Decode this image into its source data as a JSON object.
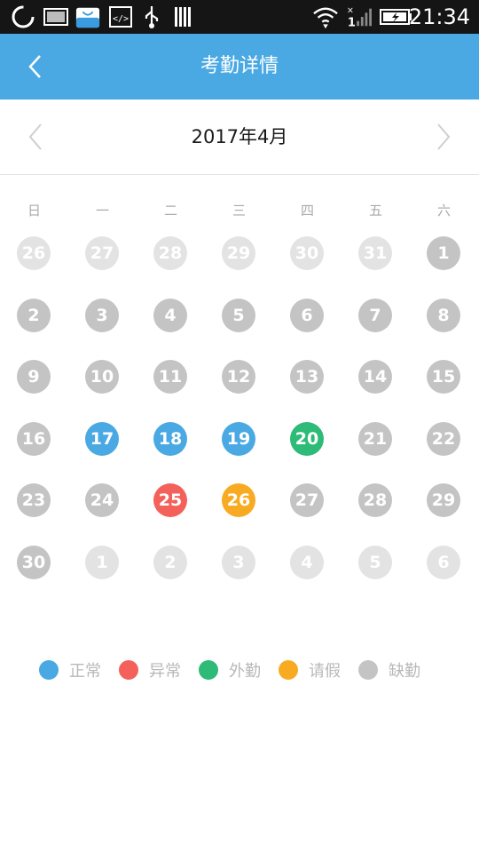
{
  "status_bar": {
    "time": "21:34",
    "icons": [
      "loading-icon",
      "image-icon",
      "store-icon",
      "code-icon",
      "usb-icon",
      "barcode-icon",
      "wifi-icon",
      "signal-icon",
      "battery-charging-icon"
    ]
  },
  "app_bar": {
    "back_icon": "chevron-left-icon",
    "title": "考勤详情",
    "color": "#4aa9e3"
  },
  "month_nav": {
    "title": "2017年4月",
    "prev_icon": "chevron-left-icon",
    "next_icon": "chevron-right-icon"
  },
  "weekdays": [
    "日",
    "一",
    "二",
    "三",
    "四",
    "五",
    "六"
  ],
  "colors": {
    "normal": "#4aa9e3",
    "abnormal": "#f4615a",
    "field": "#2dbb77",
    "leave": "#f8ab22",
    "absent": "#c4c4c4",
    "other_month": "#e3e3e3"
  },
  "calendar": [
    [
      {
        "d": "26",
        "s": "other_month"
      },
      {
        "d": "27",
        "s": "other_month"
      },
      {
        "d": "28",
        "s": "other_month"
      },
      {
        "d": "29",
        "s": "other_month"
      },
      {
        "d": "30",
        "s": "other_month"
      },
      {
        "d": "31",
        "s": "other_month"
      },
      {
        "d": "1",
        "s": "absent"
      }
    ],
    [
      {
        "d": "2",
        "s": "absent"
      },
      {
        "d": "3",
        "s": "absent"
      },
      {
        "d": "4",
        "s": "absent"
      },
      {
        "d": "5",
        "s": "absent"
      },
      {
        "d": "6",
        "s": "absent"
      },
      {
        "d": "7",
        "s": "absent"
      },
      {
        "d": "8",
        "s": "absent"
      }
    ],
    [
      {
        "d": "9",
        "s": "absent"
      },
      {
        "d": "10",
        "s": "absent"
      },
      {
        "d": "11",
        "s": "absent"
      },
      {
        "d": "12",
        "s": "absent"
      },
      {
        "d": "13",
        "s": "absent"
      },
      {
        "d": "14",
        "s": "absent"
      },
      {
        "d": "15",
        "s": "absent"
      }
    ],
    [
      {
        "d": "16",
        "s": "absent"
      },
      {
        "d": "17",
        "s": "normal"
      },
      {
        "d": "18",
        "s": "normal"
      },
      {
        "d": "19",
        "s": "normal"
      },
      {
        "d": "20",
        "s": "field"
      },
      {
        "d": "21",
        "s": "absent"
      },
      {
        "d": "22",
        "s": "absent"
      }
    ],
    [
      {
        "d": "23",
        "s": "absent"
      },
      {
        "d": "24",
        "s": "absent"
      },
      {
        "d": "25",
        "s": "abnormal"
      },
      {
        "d": "26",
        "s": "leave"
      },
      {
        "d": "27",
        "s": "absent"
      },
      {
        "d": "28",
        "s": "absent"
      },
      {
        "d": "29",
        "s": "absent"
      }
    ],
    [
      {
        "d": "30",
        "s": "absent"
      },
      {
        "d": "1",
        "s": "other_month"
      },
      {
        "d": "2",
        "s": "other_month"
      },
      {
        "d": "3",
        "s": "other_month"
      },
      {
        "d": "4",
        "s": "other_month"
      },
      {
        "d": "5",
        "s": "other_month"
      },
      {
        "d": "6",
        "s": "other_month"
      }
    ]
  ],
  "legend": [
    {
      "label": "正常",
      "status": "normal"
    },
    {
      "label": "异常",
      "status": "abnormal"
    },
    {
      "label": "外勤",
      "status": "field"
    },
    {
      "label": "请假",
      "status": "leave"
    },
    {
      "label": "缺勤",
      "status": "absent"
    }
  ]
}
